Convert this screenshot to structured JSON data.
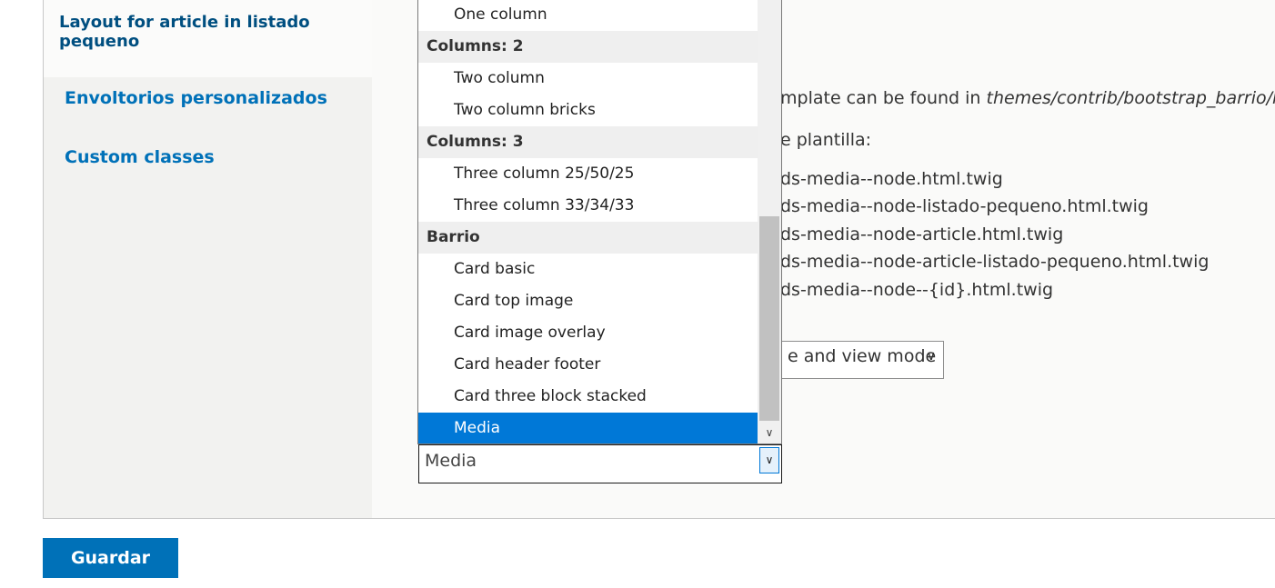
{
  "tabs": {
    "active": "Layout for article in listado pequeno",
    "items": [
      "Envoltorios personalizados",
      "Custom classes"
    ]
  },
  "content": {
    "template_prefix": "mplate can be found in ",
    "template_path": "themes/contrib/bootstrap_barrio/lay",
    "plantilla_label": "e plantilla:",
    "templates": [
      "ds-media--node.html.twig",
      "ds-media--node-listado-pequeno.html.twig",
      "ds-media--node-article.html.twig",
      "ds-media--node-article-listado-pequeno.html.twig",
      "ds-media--node--{id}.html.twig"
    ],
    "view_select": {
      "value": "e and view mode",
      "icon": "chevron-down-icon"
    }
  },
  "dropdown": {
    "rows": [
      {
        "kind": "option",
        "label": "One column"
      },
      {
        "kind": "group",
        "label": "Columns: 2"
      },
      {
        "kind": "option",
        "label": "Two column"
      },
      {
        "kind": "option",
        "label": "Two column bricks"
      },
      {
        "kind": "group",
        "label": "Columns: 3"
      },
      {
        "kind": "option",
        "label": "Three column 25/50/25"
      },
      {
        "kind": "option",
        "label": "Three column 33/34/33"
      },
      {
        "kind": "group",
        "label": "Barrio"
      },
      {
        "kind": "option",
        "label": "Card basic"
      },
      {
        "kind": "option",
        "label": "Card top image"
      },
      {
        "kind": "option",
        "label": "Card image overlay"
      },
      {
        "kind": "option",
        "label": "Card header footer"
      },
      {
        "kind": "option",
        "label": "Card three block stacked"
      },
      {
        "kind": "option",
        "label": "Media",
        "selected": true
      }
    ],
    "selected_color": "#0078d7"
  },
  "layout_select": {
    "value": "Media",
    "icon": "chevron-down-icon"
  },
  "actions": {
    "save_label": "Guardar",
    "save_color": "#0071b8"
  }
}
